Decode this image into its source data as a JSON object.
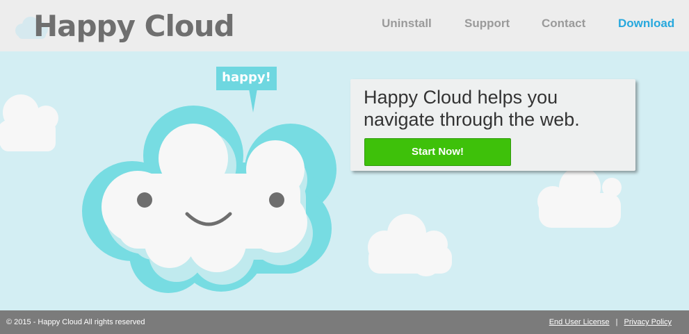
{
  "header": {
    "logo_text": "Happy Cloud",
    "nav": [
      {
        "label": "Uninstall",
        "active": false
      },
      {
        "label": "Support",
        "active": false
      },
      {
        "label": "Contact",
        "active": false
      },
      {
        "label": "Download",
        "active": true
      }
    ]
  },
  "hero": {
    "speech_bubble": "happy!",
    "headline": "Happy Cloud helps you navigate through the web.",
    "cta_label": "Start Now!",
    "icons": [
      "happy-cloud-mascot",
      "decorative-cloud"
    ]
  },
  "footer": {
    "copyright": "© 2015 - Happy Cloud All rights reserved",
    "links": [
      "End User License",
      "Privacy Policy"
    ],
    "separator": "|"
  },
  "colors": {
    "sky": "#d3eef3",
    "header_bg": "#ededed",
    "logo_gray": "#6f6f6f",
    "nav_gray": "#9a9a9a",
    "nav_active": "#27a8dd",
    "cloud_outline": "#77dce2",
    "cta_green": "#3ec10a",
    "footer_bg": "#7b7b7b"
  }
}
